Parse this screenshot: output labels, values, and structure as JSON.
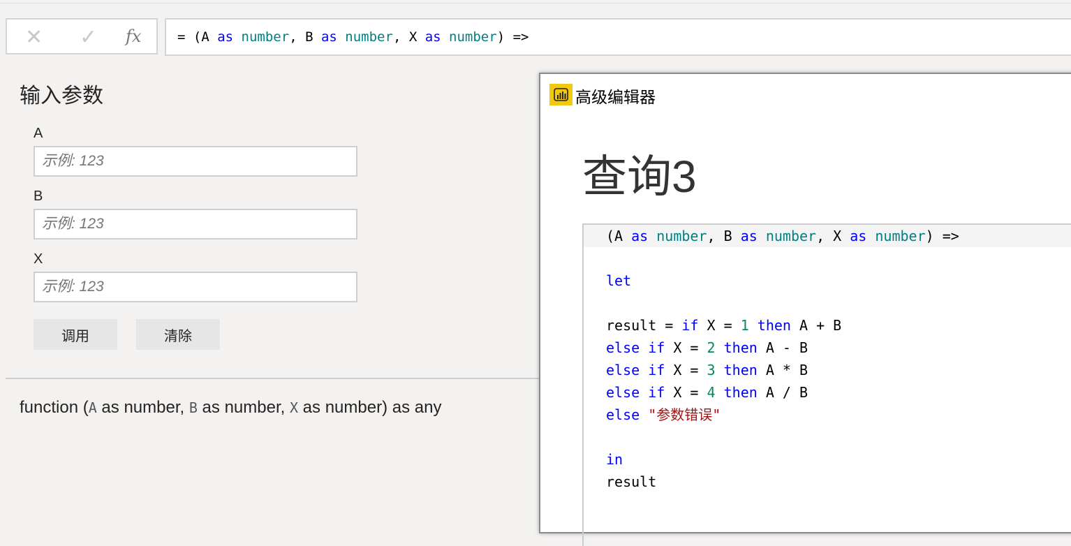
{
  "formula_bar": {
    "cancel_icon": "✕",
    "commit_icon": "✓",
    "fx_label": "fx",
    "tokens": [
      [
        "= (A ",
        ""
      ],
      [
        "as",
        "kw"
      ],
      [
        " ",
        ""
      ],
      [
        "number",
        "ty"
      ],
      [
        ", B ",
        ""
      ],
      [
        "as",
        "kw"
      ],
      [
        " ",
        ""
      ],
      [
        "number",
        "ty"
      ],
      [
        ", X ",
        ""
      ],
      [
        "as",
        "kw"
      ],
      [
        " ",
        ""
      ],
      [
        "number",
        "ty"
      ],
      [
        ") =>",
        ""
      ]
    ]
  },
  "params": {
    "title": "输入参数",
    "fields": [
      {
        "label": "A",
        "placeholder": "示例: 123"
      },
      {
        "label": "B",
        "placeholder": "示例: 123"
      },
      {
        "label": "X",
        "placeholder": "示例: 123"
      }
    ],
    "invoke_label": "调用",
    "clear_label": "清除"
  },
  "signature": {
    "prefix": "function (",
    "a": "A",
    "p1": " as number, ",
    "b": "B",
    "p2": " as number, ",
    "x": "X",
    "p3": " as number) as any"
  },
  "dialog": {
    "title": "高级编辑器",
    "query_name": "查询3",
    "code": [
      [
        [
          "(A ",
          ""
        ],
        [
          "as",
          "kw"
        ],
        [
          " ",
          ""
        ],
        [
          "number",
          "ty"
        ],
        [
          ", B ",
          ""
        ],
        [
          "as",
          "kw"
        ],
        [
          " ",
          ""
        ],
        [
          "number",
          "ty"
        ],
        [
          ", X ",
          ""
        ],
        [
          "as",
          "kw"
        ],
        [
          " ",
          ""
        ],
        [
          "number",
          "ty"
        ],
        [
          ") =>",
          ""
        ]
      ],
      [],
      [
        [
          "let",
          "kw"
        ]
      ],
      [],
      [
        [
          "result = ",
          ""
        ],
        [
          "if",
          "kw"
        ],
        [
          " X = ",
          ""
        ],
        [
          "1",
          "nm"
        ],
        [
          " ",
          ""
        ],
        [
          "then",
          "kw"
        ],
        [
          " A + B",
          ""
        ]
      ],
      [
        [
          "else if",
          "kw"
        ],
        [
          " X = ",
          ""
        ],
        [
          "2",
          "nm"
        ],
        [
          " ",
          ""
        ],
        [
          "then",
          "kw"
        ],
        [
          " A - B",
          ""
        ]
      ],
      [
        [
          "else if",
          "kw"
        ],
        [
          " X = ",
          ""
        ],
        [
          "3",
          "nm"
        ],
        [
          " ",
          ""
        ],
        [
          "then",
          "kw"
        ],
        [
          " A * B",
          ""
        ]
      ],
      [
        [
          "else if",
          "kw"
        ],
        [
          " X = ",
          ""
        ],
        [
          "4",
          "nm"
        ],
        [
          " ",
          ""
        ],
        [
          "then",
          "kw"
        ],
        [
          " A / B",
          ""
        ]
      ],
      [
        [
          "else",
          "kw"
        ],
        [
          " ",
          ""
        ],
        [
          "\"参数错误\"",
          "st"
        ]
      ],
      [],
      [
        [
          "in",
          "kw"
        ]
      ],
      [
        [
          "result",
          ""
        ]
      ]
    ]
  }
}
